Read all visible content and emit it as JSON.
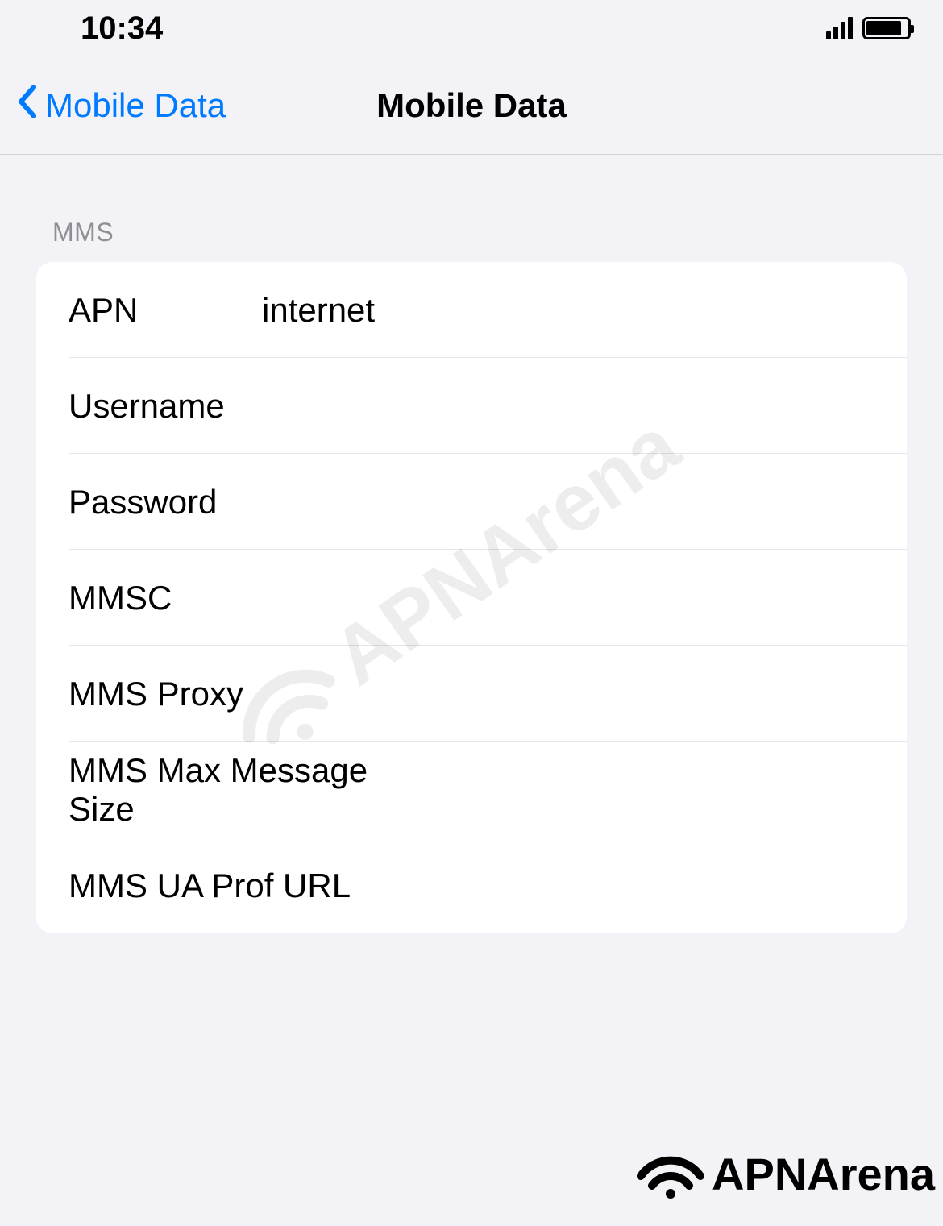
{
  "statusBar": {
    "time": "10:34"
  },
  "navBar": {
    "backLabel": "Mobile Data",
    "title": "Mobile Data"
  },
  "section": {
    "header": "MMS",
    "rows": {
      "apn": {
        "label": "APN",
        "value": "internet"
      },
      "username": {
        "label": "Username",
        "value": ""
      },
      "password": {
        "label": "Password",
        "value": ""
      },
      "mmsc": {
        "label": "MMSC",
        "value": ""
      },
      "mmsProxy": {
        "label": "MMS Proxy",
        "value": ""
      },
      "mmsMaxSize": {
        "label": "MMS Max Message Size",
        "value": ""
      },
      "mmsUaProf": {
        "label": "MMS UA Prof URL",
        "value": ""
      }
    }
  },
  "watermark": {
    "text": "APNArena"
  },
  "footer": {
    "logoText": "APNArena"
  }
}
